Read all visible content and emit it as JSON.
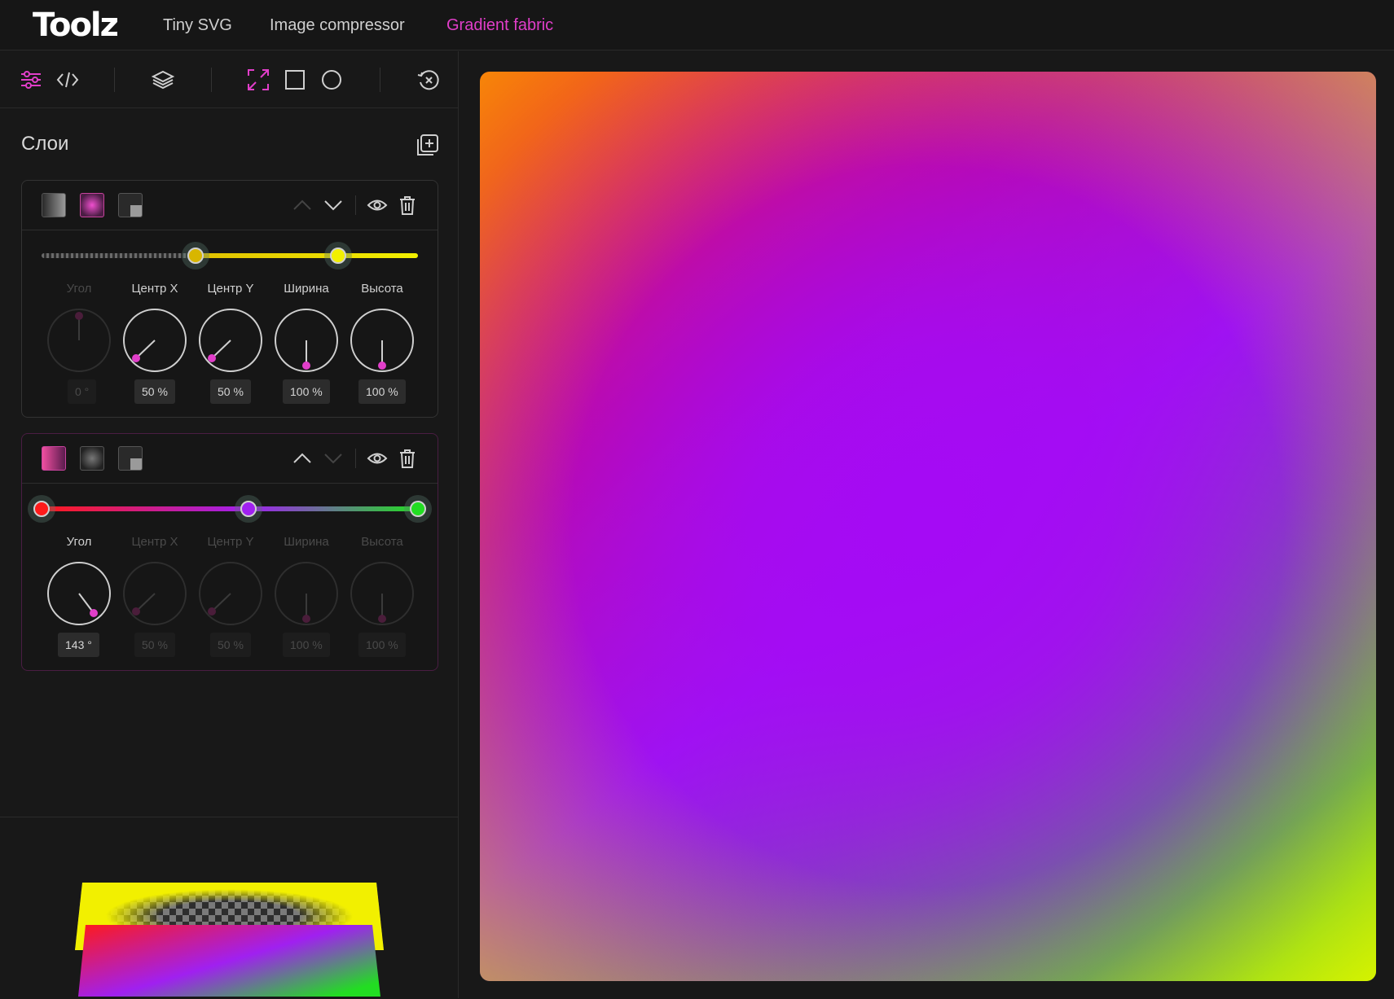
{
  "header": {
    "logo": "Toolz",
    "nav": [
      {
        "label": "Tiny SVG",
        "active": false
      },
      {
        "label": "Image compressor",
        "active": false
      },
      {
        "label": "Gradient fabric",
        "active": true
      }
    ],
    "accent": "#e13ec9"
  },
  "toolbar": {
    "icons": [
      "sliders-icon",
      "code-icon",
      "layers-icon",
      "expand-icon",
      "square-icon",
      "circle-icon",
      "reset-icon"
    ]
  },
  "layers_panel": {
    "title": "Слои",
    "layers": [
      {
        "type": "radial",
        "stops": [
          "transparent",
          "#e0c000",
          "#f2f000"
        ],
        "params": [
          {
            "label": "Угол",
            "value": "0 °",
            "enabled": false
          },
          {
            "label": "Центр X",
            "value": "50 %",
            "enabled": true
          },
          {
            "label": "Центр Y",
            "value": "50 %",
            "enabled": true
          },
          {
            "label": "Ширина",
            "value": "100 %",
            "enabled": true
          },
          {
            "label": "Высота",
            "value": "100 %",
            "enabled": true
          }
        ]
      },
      {
        "type": "linear",
        "stops": [
          "#ff1a1a",
          "#a020f0",
          "#22dd22"
        ],
        "params": [
          {
            "label": "Угол",
            "value": "143 °",
            "enabled": true
          },
          {
            "label": "Центр X",
            "value": "50 %",
            "enabled": false
          },
          {
            "label": "Центр Y",
            "value": "50 %",
            "enabled": false
          },
          {
            "label": "Ширина",
            "value": "100 %",
            "enabled": false
          },
          {
            "label": "Высота",
            "value": "100 %",
            "enabled": false
          }
        ]
      }
    ]
  }
}
